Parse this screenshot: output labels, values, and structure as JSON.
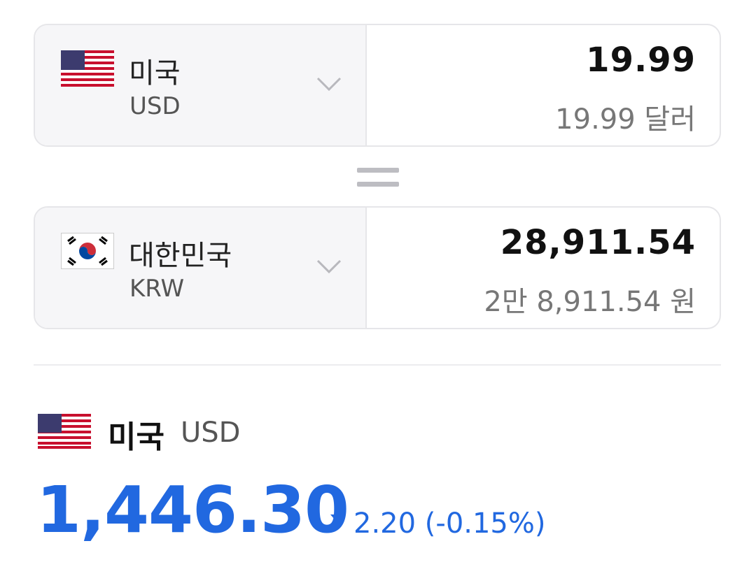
{
  "converter": {
    "from": {
      "country": "미국",
      "code": "USD",
      "amount": "19.99",
      "amount_text": "19.99 달러",
      "flag": "us-flag-icon"
    },
    "to": {
      "country": "대한민국",
      "code": "KRW",
      "amount": "28,911.54",
      "amount_text": "2만 8,911.54 원",
      "flag": "kr-flag-icon"
    }
  },
  "rate": {
    "country": "미국",
    "code": "USD",
    "value": "1,446.30",
    "change": "2.20 (-0.15%)",
    "direction": "down",
    "color": "#2168e0"
  }
}
